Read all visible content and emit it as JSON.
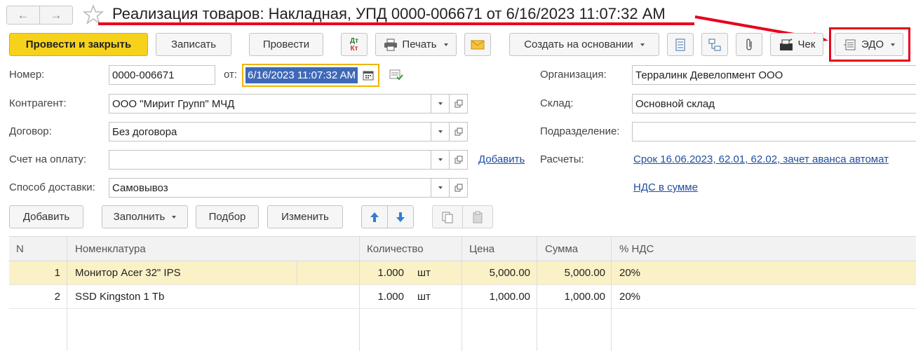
{
  "window": {
    "title": "Реализация товаров: Накладная, УПД 0000-006671 от 6/16/2023 11:07:32 AM"
  },
  "toolbar": {
    "post_close": "Провести и закрыть",
    "save": "Записать",
    "post": "Провести",
    "dtkt_top": "Дт",
    "dtkt_bottom": "Кт",
    "print": "Печать",
    "create_based": "Создать на основании",
    "receipt": "Чек",
    "edo": "ЭДО"
  },
  "form": {
    "number_label": "Номер:",
    "number_value": "0000-006671",
    "date_label": "от:",
    "date_value": "6/16/2023 11:07:32 AM",
    "org_label": "Организация:",
    "org_value": "Терралинк Девелопмент ООО",
    "counterparty_label": "Контрагент:",
    "counterparty_value": "ООО \"Мирит Групп\" МЧД",
    "warehouse_label": "Склад:",
    "warehouse_value": "Основной склад",
    "contract_label": "Договор:",
    "contract_value": "Без договора",
    "division_label": "Подразделение:",
    "division_value": "",
    "invoice_label": "Счет на оплату:",
    "invoice_value": "",
    "invoice_add_link": "Добавить",
    "settlements_label": "Расчеты:",
    "settlements_link": "Срок 16.06.2023, 62.01, 62.02, зачет аванса автомат",
    "delivery_label": "Способ доставки:",
    "delivery_value": "Самовывоз",
    "vat_link": "НДС в сумме"
  },
  "table_toolbar": {
    "add": "Добавить",
    "fill": "Заполнить",
    "select": "Подбор",
    "change": "Изменить"
  },
  "table": {
    "columns": [
      "N",
      "Номенклатура",
      "Количество",
      "Цена",
      "Сумма",
      "% НДС"
    ],
    "rows": [
      {
        "n": "1",
        "name": "Монитор Acer 32\" IPS",
        "qty": "1.000",
        "unit": "шт",
        "price": "5,000.00",
        "sum": "5,000.00",
        "vat": "20%"
      },
      {
        "n": "2",
        "name": "SSD Kingston 1 Tb",
        "qty": "1.000",
        "unit": "шт",
        "price": "1,000.00",
        "sum": "1,000.00",
        "vat": "20%"
      }
    ]
  },
  "colors": {
    "primary": "#f7d21a",
    "highlight": "#e8001c",
    "link": "#1f4e9e",
    "selected_row": "#fbf1c7"
  }
}
